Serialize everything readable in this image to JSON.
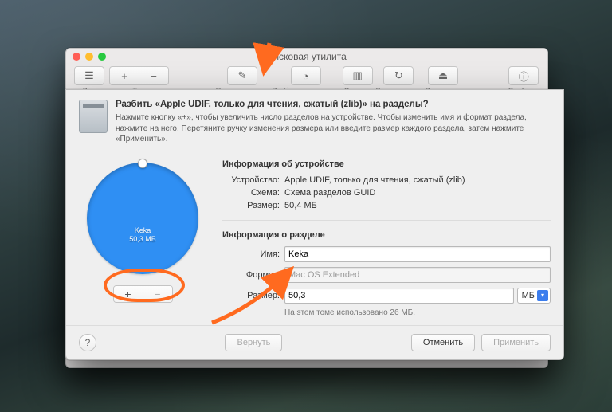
{
  "window": {
    "title": "Дисковая утилита"
  },
  "toolbar": {
    "view": "Вид",
    "volume": "Том",
    "first_aid": "Первая помощь",
    "partition": "Разбить на разделы",
    "erase": "Стереть",
    "restore": "Восстановить",
    "eject": "Отключить",
    "info": "Свойства"
  },
  "sheet": {
    "title": "Разбить «Apple UDIF, только для чтения, сжатый (zlib)» на разделы?",
    "description": "Нажмите кнопку «+», чтобы увеличить число разделов на устройстве. Чтобы изменить имя и формат раздела, нажмите на него. Перетяните ручку изменения размера или введите размер каждого раздела, затем нажмите «Применить».",
    "add_label": "+",
    "remove_label": "−",
    "revert": "Вернуть",
    "cancel": "Отменить",
    "apply": "Применить"
  },
  "device_info": {
    "heading": "Информация об устройстве",
    "device_label": "Устройство:",
    "device_value": "Apple UDIF, только для чтения, сжатый (zlib)",
    "scheme_label": "Схема:",
    "scheme_value": "Схема разделов GUID",
    "size_label": "Размер:",
    "size_value": "50,4 МБ"
  },
  "partition_info": {
    "heading": "Информация о разделе",
    "name_label": "Имя:",
    "name_value": "Keka",
    "format_label": "Формат:",
    "format_value": "Mac OS Extended",
    "size_label": "Размер:",
    "size_value": "50,3",
    "unit": "МБ",
    "usage_hint": "На этом томе использовано 26 МБ."
  },
  "chart_data": {
    "type": "pie",
    "title": "",
    "series": [
      {
        "name": "Keka",
        "size_label": "50,3 МБ",
        "value": 50.3,
        "color": "#2f8ff3"
      }
    ],
    "total": 50.4
  }
}
